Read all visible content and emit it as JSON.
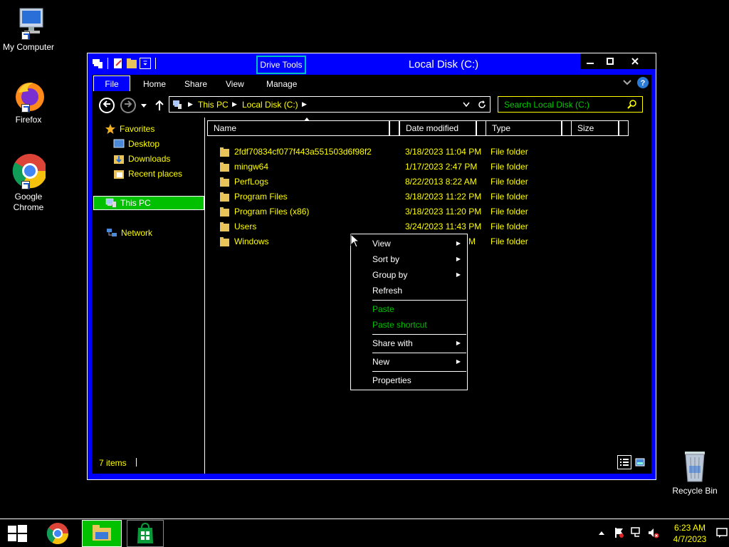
{
  "desktop": {
    "icons": [
      {
        "label": "My Computer",
        "icon": "monitor-icon"
      },
      {
        "label": "Firefox",
        "icon": "firefox-icon"
      },
      {
        "label": "Google Chrome",
        "icon": "chrome-icon"
      },
      {
        "label": "Recycle Bin",
        "icon": "recycle-bin-icon"
      }
    ]
  },
  "window": {
    "title": "Local Disk (C:)",
    "contextual_tab": "Drive Tools",
    "controls": {
      "minimize": "—",
      "maximize": "□",
      "close": "✕"
    },
    "ribbon_tabs": [
      "File",
      "Home",
      "Share",
      "View",
      "Manage"
    ],
    "address": {
      "crumbs": [
        "This PC",
        "Local Disk (C:)"
      ]
    },
    "search": {
      "placeholder": "Search Local Disk (C:)"
    },
    "nav": {
      "favorites": "Favorites",
      "favorites_items": [
        "Desktop",
        "Downloads",
        "Recent places"
      ],
      "this_pc": "This PC",
      "network": "Network"
    },
    "columns": [
      "Name",
      "Date modified",
      "Type",
      "Size"
    ],
    "files": [
      {
        "name": "2fdf70834cf077f443a551503d6f98f2",
        "date": "3/18/2023 11:04 PM",
        "type": "File folder"
      },
      {
        "name": "mingw64",
        "date": "1/17/2023 2:47 PM",
        "type": "File folder"
      },
      {
        "name": "PerfLogs",
        "date": "8/22/2013 8:22 AM",
        "type": "File folder"
      },
      {
        "name": "Program Files",
        "date": "3/18/2023 11:22 PM",
        "type": "File folder"
      },
      {
        "name": "Program Files (x86)",
        "date": "3/18/2023 11:20 PM",
        "type": "File folder"
      },
      {
        "name": "Users",
        "date": "3/24/2023 11:43 PM",
        "type": "File folder"
      },
      {
        "name": "Windows",
        "date": "M",
        "type": "File folder"
      }
    ],
    "status": {
      "items_count": "7 items"
    }
  },
  "context_menu": {
    "items": [
      {
        "label": "View",
        "submenu": true,
        "enabled": true
      },
      {
        "label": "Sort by",
        "submenu": true,
        "enabled": true
      },
      {
        "label": "Group by",
        "submenu": true,
        "enabled": true
      },
      {
        "label": "Refresh",
        "submenu": false,
        "enabled": true
      },
      {
        "label": "Paste",
        "submenu": false,
        "enabled": false
      },
      {
        "label": "Paste shortcut",
        "submenu": false,
        "enabled": false
      },
      {
        "label": "Share with",
        "submenu": true,
        "enabled": true
      },
      {
        "label": "New",
        "submenu": true,
        "enabled": true
      },
      {
        "label": "Properties",
        "submenu": false,
        "enabled": true
      }
    ]
  },
  "taskbar": {
    "clock_time": "6:23 AM",
    "clock_date": "4/7/2023"
  },
  "colors": {
    "window_frame": "#0000ff",
    "text_primary": "#ffff00",
    "selected": "#00c000",
    "disabled_menu": "#00c000"
  }
}
